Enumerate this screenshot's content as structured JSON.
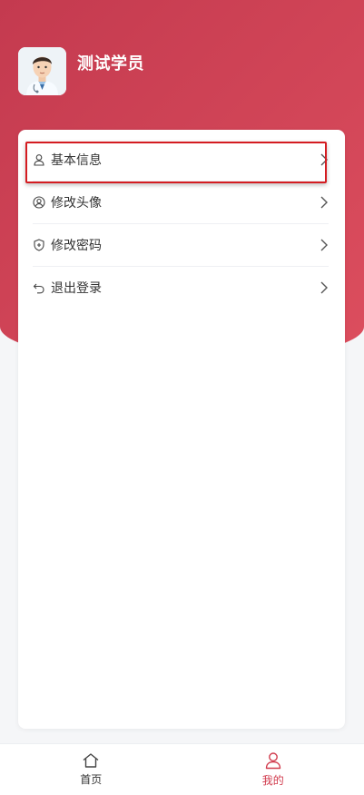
{
  "profile": {
    "name": "测试学员"
  },
  "menu": {
    "items": [
      {
        "label": "基本信息",
        "icon": "user-icon"
      },
      {
        "label": "修改头像",
        "icon": "avatar-icon"
      },
      {
        "label": "修改密码",
        "icon": "shield-icon"
      },
      {
        "label": "退出登录",
        "icon": "logout-icon"
      }
    ]
  },
  "tabbar": {
    "items": [
      {
        "label": "首页",
        "icon": "home-icon"
      },
      {
        "label": "我的",
        "icon": "profile-icon",
        "active": true
      }
    ]
  },
  "colors": {
    "accent": "#d13b4d",
    "highlight_border": "#d41c21",
    "hero": "#c43a4f"
  }
}
